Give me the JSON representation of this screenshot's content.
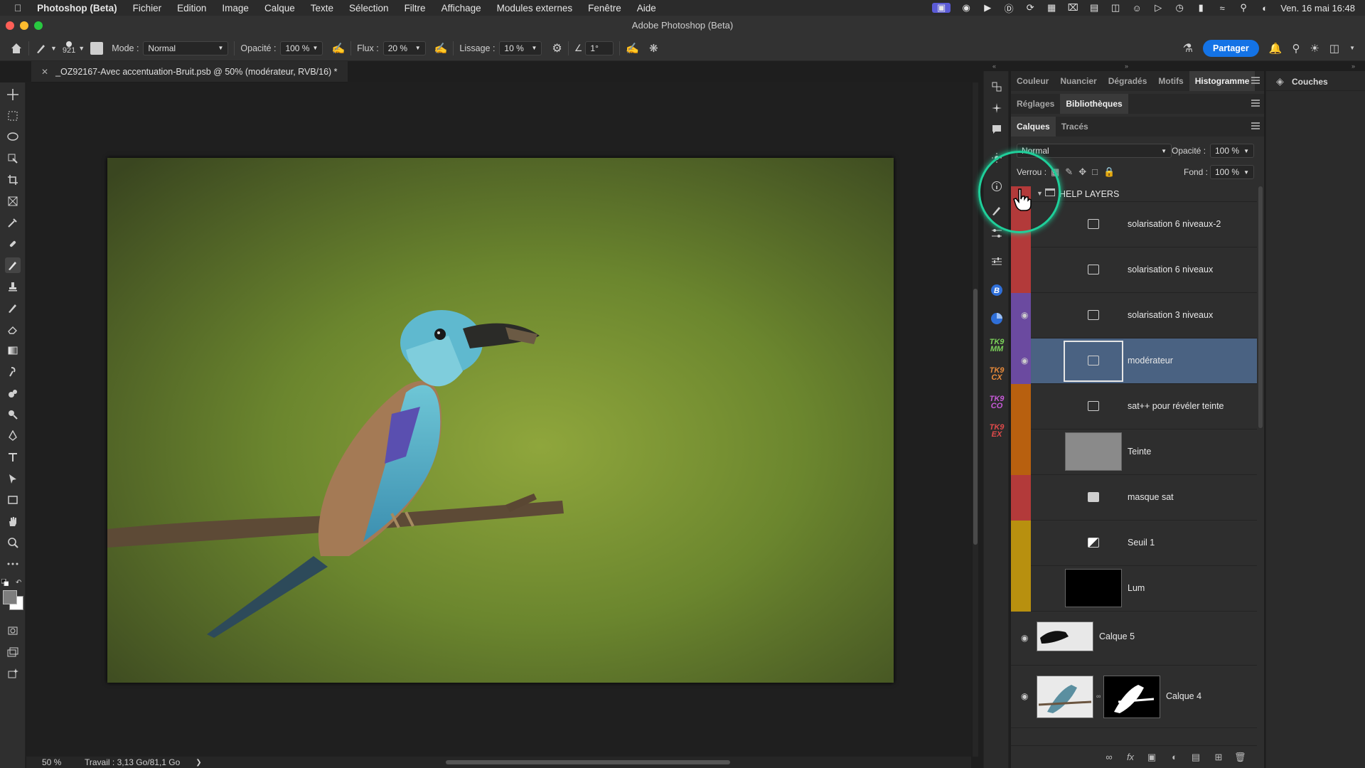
{
  "menubar": {
    "app": "Photoshop (Beta)",
    "items": [
      "Fichier",
      "Edition",
      "Image",
      "Calque",
      "Texte",
      "Sélection",
      "Filtre",
      "Affichage",
      "Modules externes",
      "Fenêtre",
      "Aide"
    ],
    "clock": "Ven. 16 mai  16:48"
  },
  "window": {
    "title": "Adobe Photoshop (Beta)"
  },
  "options": {
    "brush_size": "921",
    "mode_label": "Mode :",
    "mode_value": "Normal",
    "opacity_label": "Opacité :",
    "opacity_value": "100 %",
    "flux_label": "Flux :",
    "flux_value": "20 %",
    "lissage_label": "Lissage :",
    "lissage_value": "10 %",
    "angle_value": "1°",
    "share_label": "Partager"
  },
  "document": {
    "tab_title": "_OZ92167-Avec accentuation-Bruit.psb @ 50% (modérateur, RVB/16) *",
    "zoom": "50 %",
    "status": "Travail : 3,13 Go/81,1 Go"
  },
  "iconstrip": {
    "tk1": "TK9 MM",
    "tk2": "TK9 CX",
    "tk3": "TK9 CO",
    "tk4": "TK9 EX"
  },
  "panels": {
    "row1_tabs": [
      "Couleur",
      "Nuancier",
      "Dégradés",
      "Motifs",
      "Histogramme"
    ],
    "row2_tabs": [
      "Réglages",
      "Bibliothèques"
    ],
    "row3_tabs": [
      "Calques",
      "Tracés"
    ],
    "blend_mode": "Normal",
    "opacity_label": "Opacité :",
    "opacity_value": "100 %",
    "lock_label": "Verrou :",
    "fill_label": "Fond :",
    "fill_value": "100 %",
    "channels_tab": "Couches"
  },
  "layers": [
    {
      "name": "HELP LAYERS",
      "type": "group",
      "color": "#b33a3a",
      "visible": false
    },
    {
      "name": "solarisation 6 niveaux-2",
      "type": "adjust",
      "color": "#b33a3a",
      "visible": false
    },
    {
      "name": "solarisation 6 niveaux",
      "type": "adjust",
      "color": "#b33a3a",
      "visible": false
    },
    {
      "name": "solarisation 3 niveaux",
      "type": "adjust",
      "color": "#6b4aa0",
      "visible": true
    },
    {
      "name": "modérateur",
      "type": "adjust",
      "color": "#6b4aa0",
      "visible": true,
      "selected": true
    },
    {
      "name": "sat++ pour révéler teinte",
      "type": "adjust",
      "color": "#b8600f",
      "visible": false
    },
    {
      "name": "Teinte",
      "type": "fill-gray",
      "color": "#b8600f",
      "visible": false
    },
    {
      "name": "masque sat",
      "type": "adjust",
      "color": "#b33a3a",
      "visible": false
    },
    {
      "name": "Seuil 1",
      "type": "adjust",
      "color": "#b8900f",
      "visible": false
    },
    {
      "name": "Lum",
      "type": "fill-black",
      "color": "#b8900f",
      "visible": false
    },
    {
      "name": "Calque 5",
      "type": "pixel",
      "visible": true
    },
    {
      "name": "Calque 4",
      "type": "pixel-mask",
      "visible": true
    }
  ]
}
